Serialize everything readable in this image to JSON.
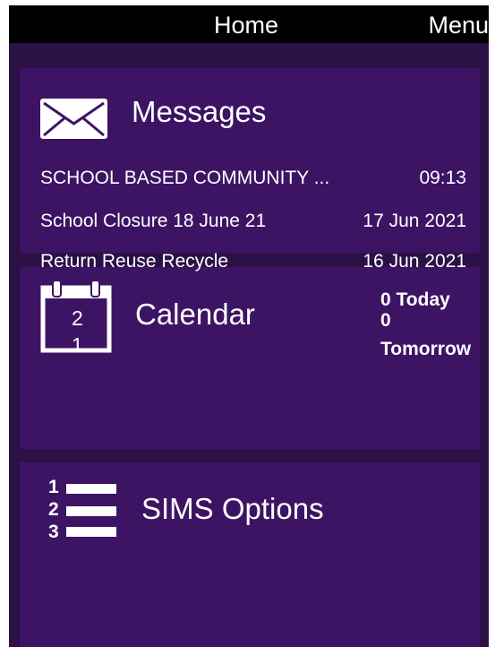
{
  "header": {
    "title": "Home",
    "menu_label": "Menu"
  },
  "messages": {
    "title": "Messages",
    "icon": "envelope-icon",
    "items": [
      {
        "subject": "SCHOOL BASED COMMUNITY ...",
        "date": "09:13"
      },
      {
        "subject": "School Closure 18 June 21",
        "date": "17 Jun 2021"
      },
      {
        "subject": "Return Reuse Recycle",
        "date": "16 Jun 2021"
      }
    ]
  },
  "calendar": {
    "title": "Calendar",
    "icon": "calendar-icon",
    "icon_day": "21",
    "today_count": "0",
    "today_label": "Today",
    "tomorrow_count": "0",
    "tomorrow_label": "Tomorrow"
  },
  "sims": {
    "title": "SIMS Options",
    "icon": "numbered-list-icon"
  },
  "colors": {
    "background": "#2b1146",
    "card": "#3d1464",
    "header": "#000000",
    "text": "#ffffff"
  }
}
